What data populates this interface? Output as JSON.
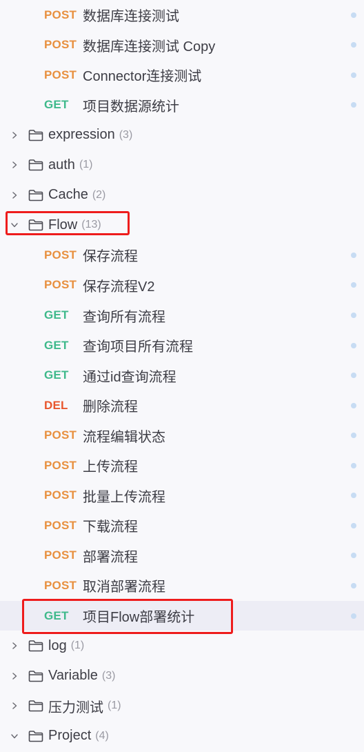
{
  "top_requests": [
    {
      "method": "POST",
      "name": "数据库连接测试"
    },
    {
      "method": "POST",
      "name": "数据库连接测试 Copy"
    },
    {
      "method": "POST",
      "name": "Connector连接测试"
    },
    {
      "method": "GET",
      "name": "项目数据源统计"
    }
  ],
  "folders_before": [
    {
      "name": "expression",
      "count": "(3)"
    },
    {
      "name": "auth",
      "count": "(1)"
    },
    {
      "name": "Cache",
      "count": "(2)"
    }
  ],
  "flow_folder": {
    "name": "Flow",
    "count": "(13)",
    "expanded": true
  },
  "flow_requests": [
    {
      "method": "POST",
      "name": "保存流程"
    },
    {
      "method": "POST",
      "name": "保存流程V2"
    },
    {
      "method": "GET",
      "name": "查询所有流程"
    },
    {
      "method": "GET",
      "name": "查询项目所有流程"
    },
    {
      "method": "GET",
      "name": "通过id查询流程"
    },
    {
      "method": "DEL",
      "name": "删除流程"
    },
    {
      "method": "POST",
      "name": "流程编辑状态"
    },
    {
      "method": "POST",
      "name": "上传流程"
    },
    {
      "method": "POST",
      "name": "批量上传流程"
    },
    {
      "method": "POST",
      "name": "下载流程"
    },
    {
      "method": "POST",
      "name": "部署流程"
    },
    {
      "method": "POST",
      "name": "取消部署流程"
    },
    {
      "method": "GET",
      "name": "项目Flow部署统计",
      "selected": true
    }
  ],
  "folders_after": [
    {
      "name": "log",
      "count": "(1)"
    },
    {
      "name": "Variable",
      "count": "(3)"
    },
    {
      "name": "压力测试",
      "count": "(1)"
    }
  ],
  "project_folder": {
    "name": "Project",
    "count": "(4)",
    "expanded": true
  },
  "colors": {
    "post": "#e8903f",
    "get": "#3fb98b",
    "del": "#e8562d",
    "highlight": "#ee1c1c",
    "selected_bg": "#ededf5"
  }
}
